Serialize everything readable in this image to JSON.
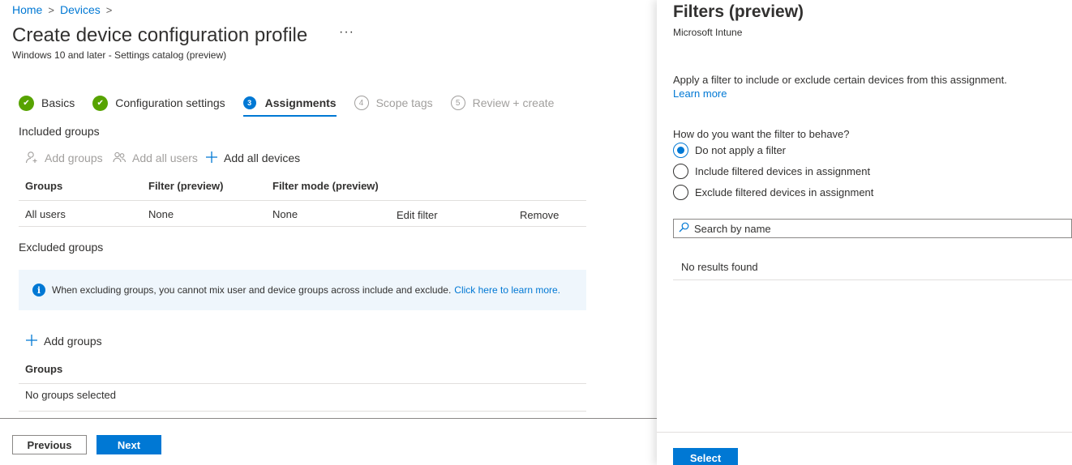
{
  "breadcrumb": {
    "items": [
      "Home",
      "Devices"
    ],
    "separator": ">"
  },
  "page": {
    "title": "Create device configuration profile",
    "more_label": "···",
    "subtitle": "Windows 10 and later - Settings catalog (preview)"
  },
  "wizard": {
    "steps": [
      {
        "label": "Basics",
        "state": "done",
        "badge": "✔"
      },
      {
        "label": "Configuration settings",
        "state": "done",
        "badge": "✔"
      },
      {
        "label": "Assignments",
        "state": "current",
        "badge": "3"
      },
      {
        "label": "Scope tags",
        "state": "todo",
        "badge": "4"
      },
      {
        "label": "Review + create",
        "state": "todo",
        "badge": "5"
      }
    ]
  },
  "included": {
    "label": "Included groups",
    "commands": {
      "add_groups": "Add groups",
      "add_all_users": "Add all users",
      "add_all_devices": "Add all devices"
    },
    "columns": [
      "Groups",
      "Filter (preview)",
      "Filter mode (preview)"
    ],
    "rows": [
      {
        "group": "All users",
        "filter": "None",
        "mode": "None",
        "edit": "Edit filter",
        "remove": "Remove"
      }
    ]
  },
  "excluded": {
    "label": "Excluded groups",
    "info_text": "When excluding groups, you cannot mix user and device groups across include and exclude.",
    "info_link": "Click here to learn more.",
    "add_groups": "Add groups",
    "column": "Groups",
    "empty": "No groups selected"
  },
  "footer": {
    "previous": "Previous",
    "next": "Next"
  },
  "panel": {
    "title": "Filters (preview)",
    "subtitle": "Microsoft Intune",
    "description": "Apply a filter to include or exclude certain devices from this assignment.",
    "learn_more": "Learn more",
    "question": "How do you want the filter to behave?",
    "options": [
      {
        "label": "Do not apply a filter",
        "checked": true
      },
      {
        "label": "Include filtered devices in assignment",
        "checked": false
      },
      {
        "label": "Exclude filtered devices in assignment",
        "checked": false
      }
    ],
    "search_placeholder": "Search by name",
    "no_results": "No results found",
    "select_label": "Select"
  },
  "colors": {
    "accent": "#0078d4",
    "success": "#57a300",
    "info_bg": "#eff6fc"
  }
}
